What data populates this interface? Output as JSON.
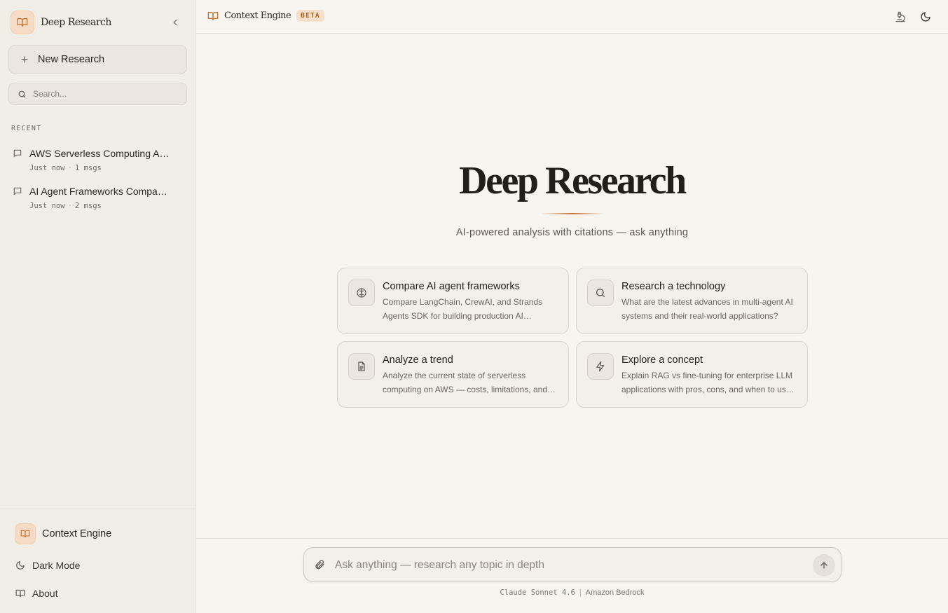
{
  "sidebar": {
    "app_title": "Deep Research",
    "new_research_label": "New Research",
    "search_placeholder": "Search...",
    "recent_heading": "RECENT",
    "recent": [
      {
        "title": "AWS Serverless Computing Analysis",
        "time": "Just now",
        "msgs": "1 msgs"
      },
      {
        "title": "AI Agent Frameworks Comparison",
        "time": "Just now",
        "msgs": "2 msgs"
      }
    ],
    "footer": {
      "app_name": "Context Engine",
      "dark_mode_label": "Dark Mode",
      "about_label": "About"
    }
  },
  "topbar": {
    "brand": "Context Engine",
    "badge": "BETA"
  },
  "hero": {
    "title": "Deep Research",
    "subtitle": "AI-powered analysis with citations — ask anything"
  },
  "cards": [
    {
      "icon": "brain-icon",
      "title": "Compare AI agent frameworks",
      "desc": "Compare LangChain, CrewAI, and Strands Agents SDK for building production AI applications"
    },
    {
      "icon": "search-icon",
      "title": "Research a technology",
      "desc": "What are the latest advances in multi-agent AI systems and their real-world applications?"
    },
    {
      "icon": "document-icon",
      "title": "Analyze a trend",
      "desc": "Analyze the current state of serverless computing on AWS — costs, limitations, and best practices"
    },
    {
      "icon": "lightning-icon",
      "title": "Explore a concept",
      "desc": "Explain RAG vs fine-tuning for enterprise LLM applications with pros, cons, and when to use each"
    }
  ],
  "composer": {
    "placeholder": "Ask anything — research any topic in depth",
    "model": "Claude Sonnet 4.6",
    "provider": "Amazon Bedrock"
  },
  "colors": {
    "accent": "#c77434",
    "badge_bg": "#f6e0cc",
    "background": "#f8f5f1",
    "sidebar_bg": "#f1ede7"
  }
}
